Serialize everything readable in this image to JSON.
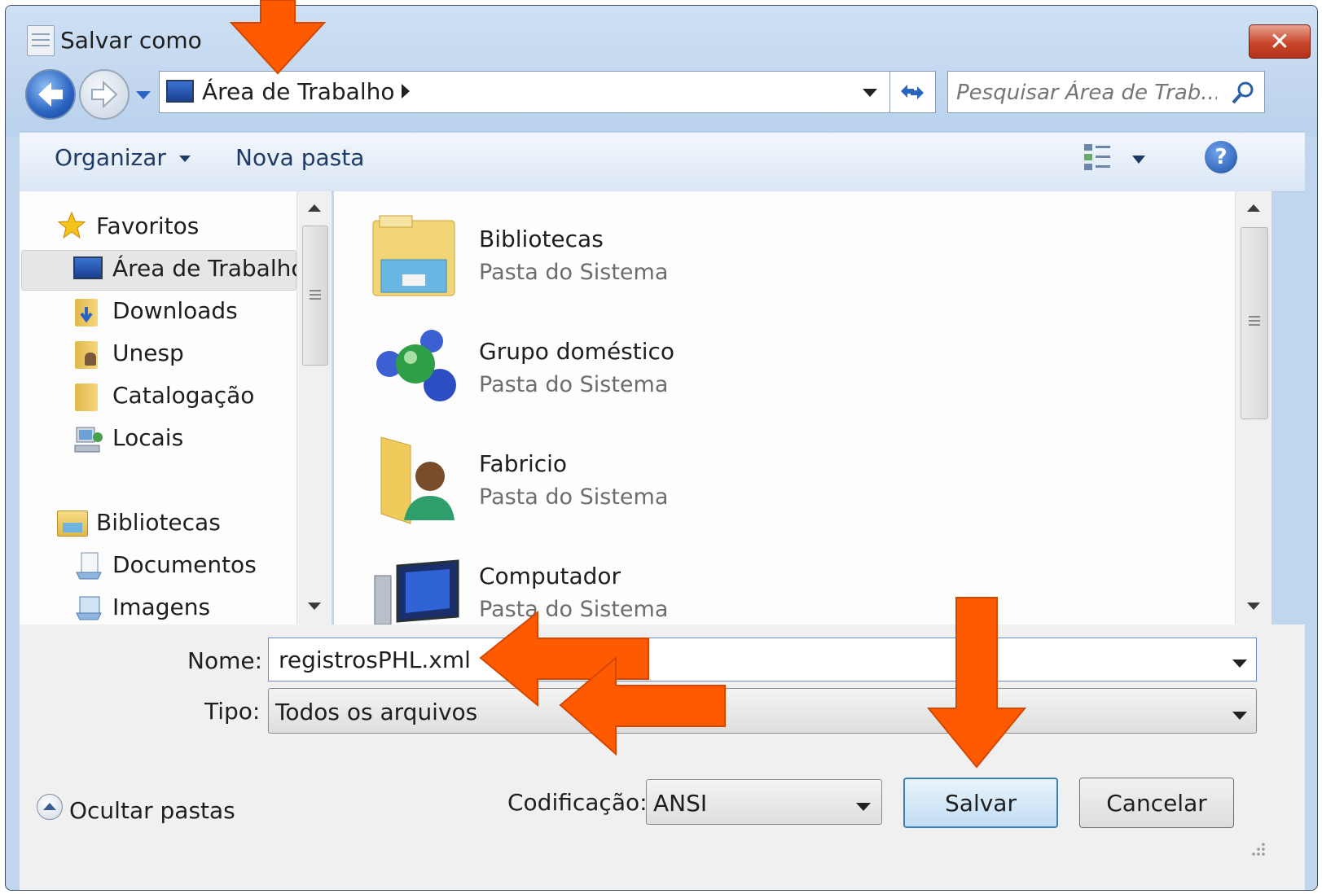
{
  "dialog": {
    "title": "Salvar como"
  },
  "address": {
    "location": "Área de Trabalho"
  },
  "search": {
    "placeholder": "Pesquisar Área de Trab..."
  },
  "toolbar": {
    "organize": "Organizar",
    "new_folder": "Nova pasta"
  },
  "nav": {
    "favorites_header": "Favoritos",
    "favorites": [
      "Área de Trabalho",
      "Downloads",
      "Unesp",
      "Catalogação",
      "Locais"
    ],
    "libraries_header": "Bibliotecas",
    "libraries": [
      "Documentos",
      "Imagens"
    ]
  },
  "items": [
    {
      "name": "Bibliotecas",
      "type": "Pasta do Sistema"
    },
    {
      "name": "Grupo doméstico",
      "type": "Pasta do Sistema"
    },
    {
      "name": "Fabricio",
      "type": "Pasta do Sistema"
    },
    {
      "name": "Computador",
      "type": "Pasta do Sistema"
    }
  ],
  "form": {
    "name_label": "Nome:",
    "name_value": "registrosPHL.xml",
    "type_label": "Tipo:",
    "type_value": "Todos os arquivos",
    "encoding_label": "Codificação:",
    "encoding_value": "ANSI"
  },
  "footer": {
    "hide_folders": "Ocultar pastas",
    "save": "Salvar",
    "cancel": "Cancelar"
  },
  "colors": {
    "accent_arrow": "#ff5a00",
    "window_frame": "#bfd6ee",
    "close_button": "#c9472c"
  }
}
